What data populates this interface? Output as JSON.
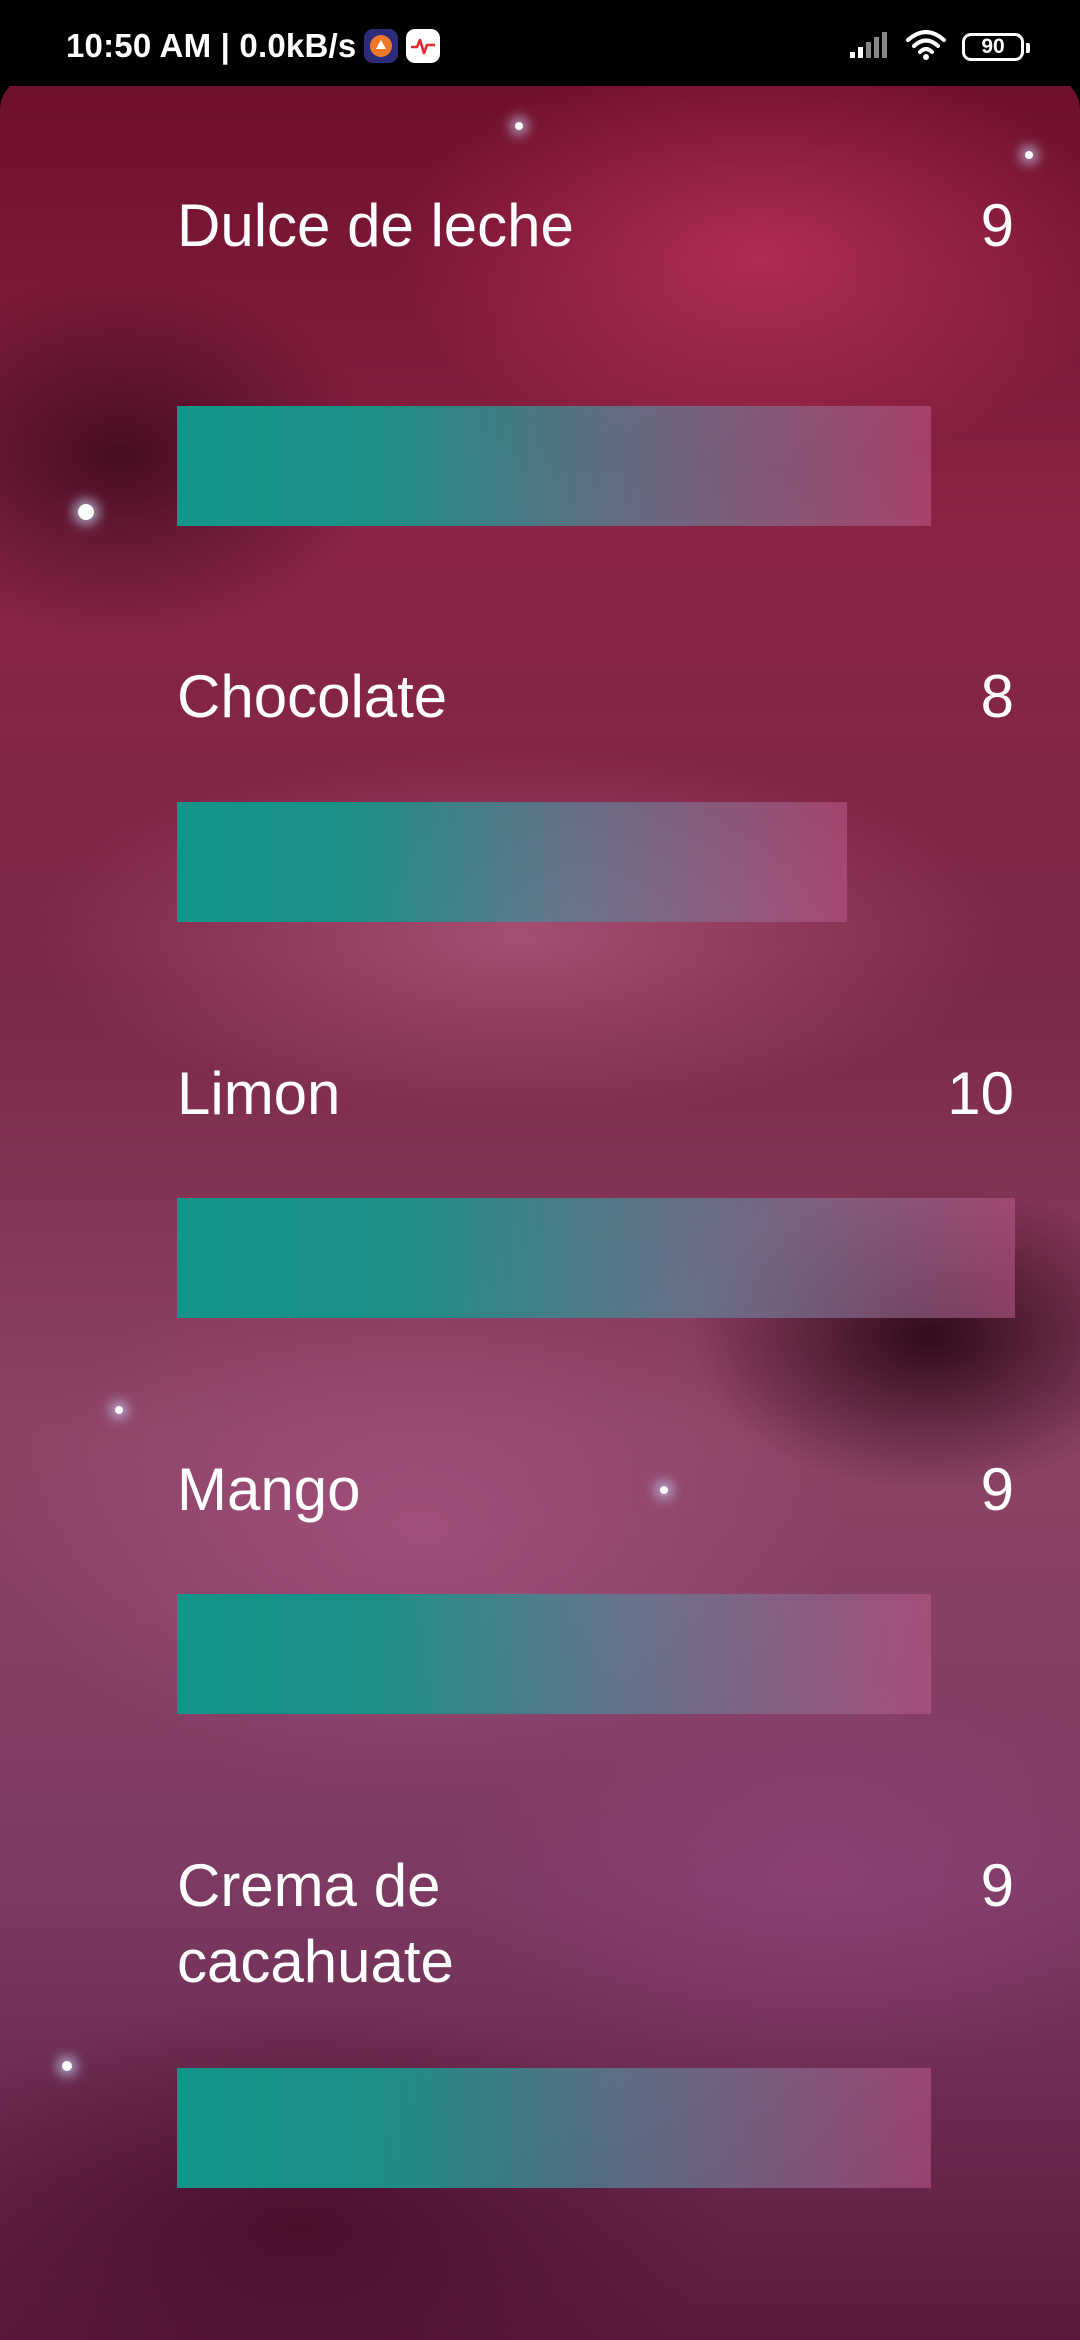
{
  "status_bar": {
    "time_speed": "10:50 AM | 0.0kB/s",
    "battery": "90"
  },
  "items": [
    {
      "title": "Dulce de leche",
      "score": "9",
      "fill_percent": 90
    },
    {
      "title": "Chocolate",
      "score": "8",
      "fill_percent": 80
    },
    {
      "title": "Limon",
      "score": "10",
      "fill_percent": 100
    },
    {
      "title": "Mango",
      "score": "9",
      "fill_percent": 90
    },
    {
      "title": "Crema de cacahuate",
      "score": "9",
      "fill_percent": 90
    }
  ],
  "colors": {
    "bar_fill": "#14958A",
    "text": "#FFFFFF"
  }
}
